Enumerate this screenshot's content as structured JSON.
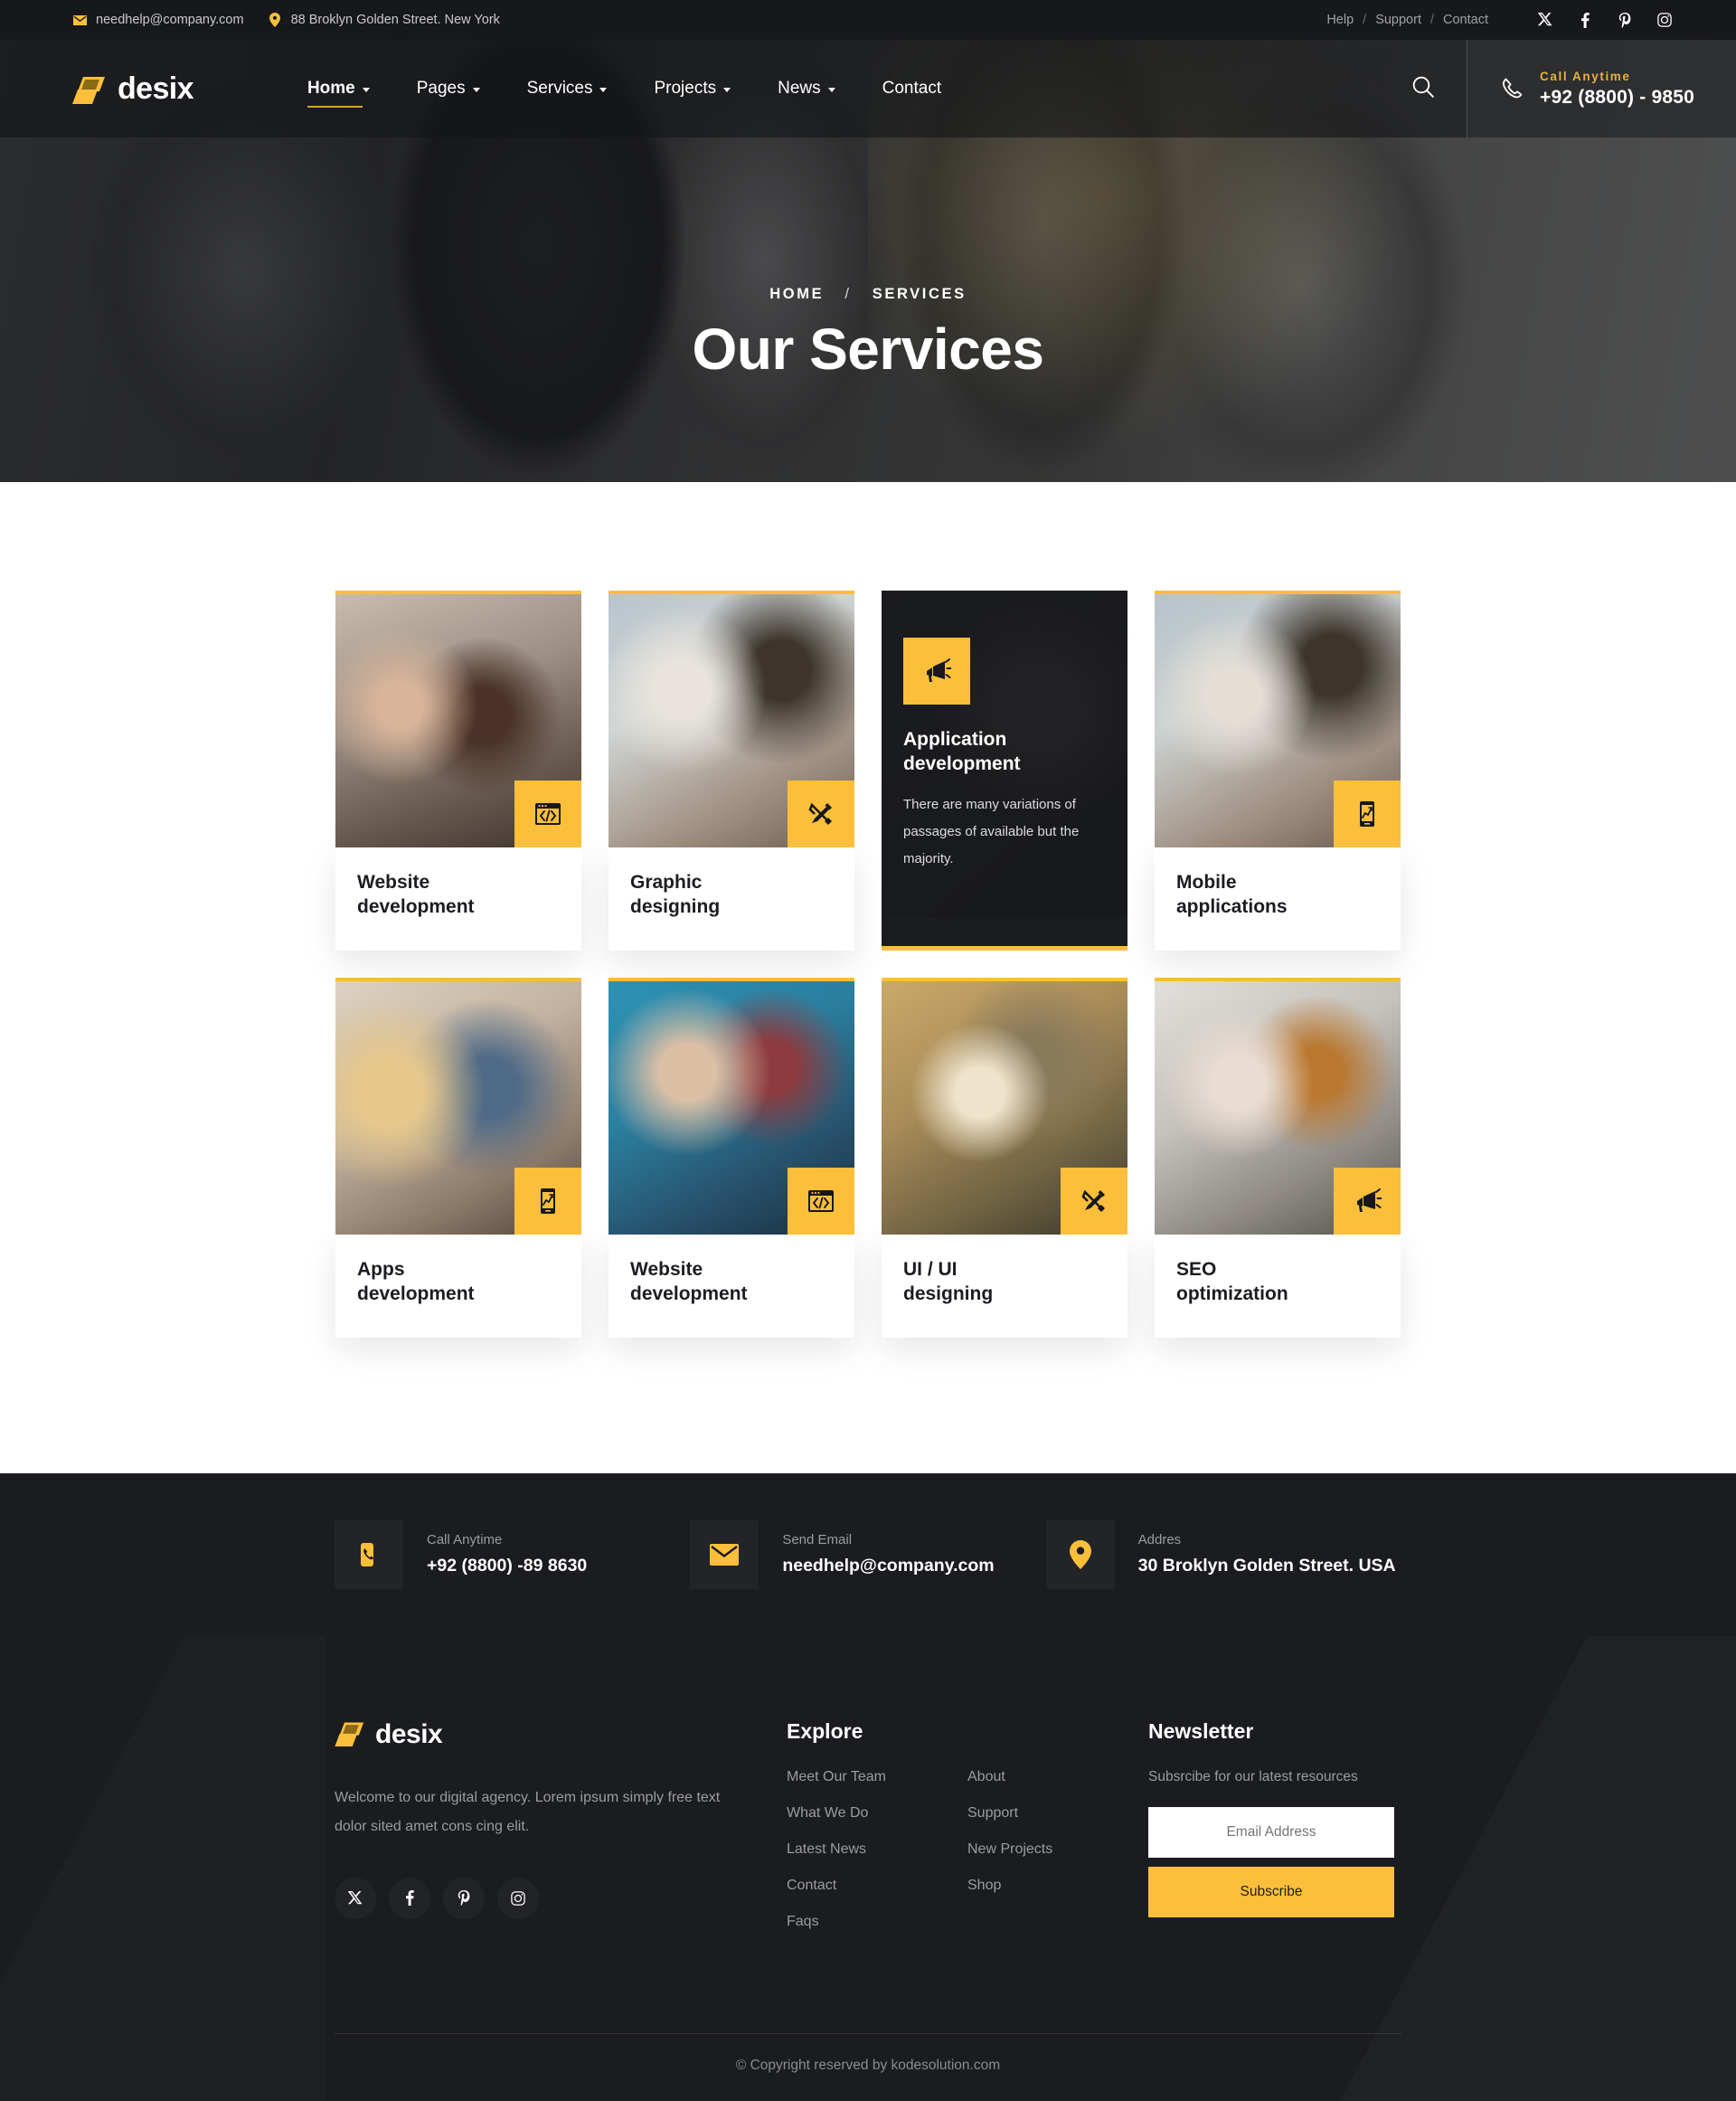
{
  "topbar": {
    "email": "needhelp@company.com",
    "address": "88 Broklyn Golden Street. New York",
    "links": [
      "Help",
      "Support",
      "Contact"
    ],
    "separator": "/",
    "social": [
      "x-icon",
      "facebook-icon",
      "pinterest-icon",
      "instagram-icon"
    ]
  },
  "header": {
    "logo": "desix",
    "nav": [
      {
        "label": "Home",
        "has_dropdown": true,
        "active": true
      },
      {
        "label": "Pages",
        "has_dropdown": true,
        "active": false
      },
      {
        "label": "Services",
        "has_dropdown": true,
        "active": false
      },
      {
        "label": "Projects",
        "has_dropdown": true,
        "active": false
      },
      {
        "label": "News",
        "has_dropdown": true,
        "active": false
      },
      {
        "label": "Contact",
        "has_dropdown": false,
        "active": false
      }
    ],
    "call_label": "Call Anytime",
    "call_number": "+92 (8800) - 9850"
  },
  "hero": {
    "crumb_home": "HOME",
    "crumb_sep": "/",
    "crumb_current": "SERVICES",
    "title": "Our Services"
  },
  "services": [
    {
      "title_line1": "Website",
      "title_line2": "development",
      "icon": "code-window-icon",
      "active": false
    },
    {
      "title_line1": "Graphic",
      "title_line2": "designing",
      "icon": "pencil-ruler-icon",
      "active": false
    },
    {
      "title_line1": "Application",
      "title_line2": "development",
      "icon": "megaphone-icon",
      "active": true,
      "description": "There are many variations of passages of available but the majority."
    },
    {
      "title_line1": "Mobile",
      "title_line2": "applications",
      "icon": "mobile-chart-icon",
      "active": false
    },
    {
      "title_line1": "Apps",
      "title_line2": "development",
      "icon": "mobile-chart-icon",
      "active": false
    },
    {
      "title_line1": "Website",
      "title_line2": "development",
      "icon": "code-window-icon",
      "active": false
    },
    {
      "title_line1": "UI / UI",
      "title_line2": "designing",
      "icon": "pencil-ruler-icon",
      "active": false
    },
    {
      "title_line1": "SEO",
      "title_line2": "optimization",
      "icon": "megaphone-icon",
      "active": false
    }
  ],
  "contact_bar": [
    {
      "icon": "phone-icon",
      "label": "Call Anytime",
      "value": "+92 (8800) -89 8630"
    },
    {
      "icon": "envelope-icon",
      "label": "Send Email",
      "value": "needhelp@company.com"
    },
    {
      "icon": "location-pin-icon",
      "label": "Addres",
      "value": "30 Broklyn Golden Street. USA"
    }
  ],
  "footer": {
    "logo": "desix",
    "about": "Welcome to our digital agency. Lorem ipsum simply free text dolor sited amet cons cing elit.",
    "social": [
      "x-icon",
      "facebook-icon",
      "pinterest-icon",
      "instagram-icon"
    ],
    "explore_heading": "Explore",
    "explore_col1": [
      "Meet Our Team",
      "What We Do",
      "Latest News",
      "Contact",
      "Faqs"
    ],
    "explore_col2": [
      "About",
      "Support",
      "New Projects",
      "Shop"
    ],
    "newsletter_heading": "Newsletter",
    "newsletter_subtitle": "Subsrcibe for our latest resources",
    "email_placeholder": "Email Address",
    "subscribe_label": "Subscribe",
    "copyright": "© Copyright reserved by kodesolution.com"
  },
  "colors": {
    "accent": "#fbbf3b",
    "dark": "#1b1c20",
    "topbar": "#17181c",
    "muted": "#9a9ca1"
  }
}
